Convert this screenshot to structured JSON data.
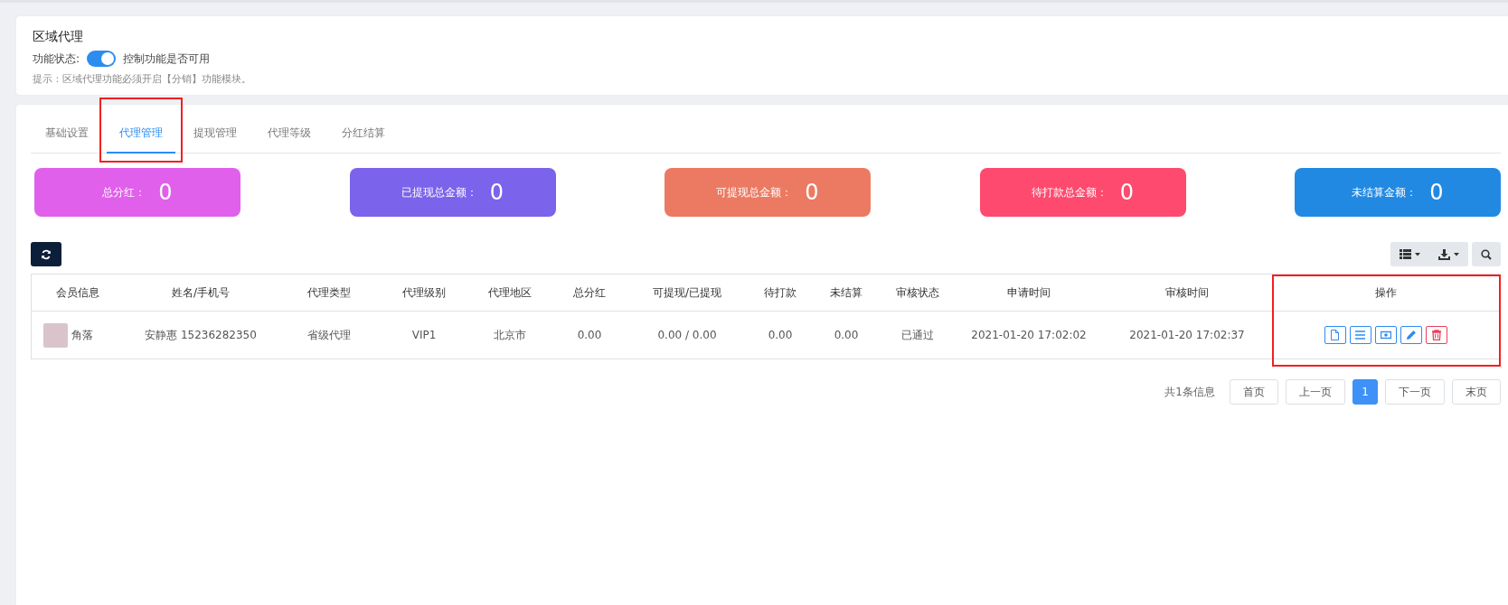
{
  "feature_card": {
    "title": "区域代理",
    "status_label": "功能状态:",
    "toggle_on": true,
    "toggle_hint": "控制功能是否可用",
    "tip": "提示：区域代理功能必须开启【分销】功能模块。"
  },
  "tabs": [
    {
      "label": "基础设置",
      "selected": false,
      "highlighted": false
    },
    {
      "label": "代理管理",
      "selected": true,
      "highlighted": true
    },
    {
      "label": "提现管理",
      "selected": false,
      "highlighted": false
    },
    {
      "label": "代理等级",
      "selected": false,
      "highlighted": false
    },
    {
      "label": "分红结算",
      "selected": false,
      "highlighted": false
    }
  ],
  "stats": [
    {
      "label": "总分红：",
      "value": "0",
      "color": "#e060eb"
    },
    {
      "label": "已提现总金额：",
      "value": "0",
      "color": "#7b63eb"
    },
    {
      "label": "可提现总金额：",
      "value": "0",
      "color": "#ec7a62"
    },
    {
      "label": "待打款总金额：",
      "value": "0",
      "color": "#fd4a6e"
    },
    {
      "label": "未结算金额：",
      "value": "0",
      "color": "#2289e2"
    }
  ],
  "table": {
    "columns": [
      {
        "label": "会员信息",
        "highlighted": false
      },
      {
        "label": "姓名/手机号",
        "highlighted": false
      },
      {
        "label": "代理类型",
        "highlighted": false
      },
      {
        "label": "代理级别",
        "highlighted": false
      },
      {
        "label": "代理地区",
        "highlighted": false
      },
      {
        "label": "总分红",
        "highlighted": false
      },
      {
        "label": "可提现/已提现",
        "highlighted": false
      },
      {
        "label": "待打款",
        "highlighted": false
      },
      {
        "label": "未结算",
        "highlighted": false
      },
      {
        "label": "审核状态",
        "highlighted": false
      },
      {
        "label": "申请时间",
        "highlighted": false
      },
      {
        "label": "审核时间",
        "highlighted": false
      },
      {
        "label": "操作",
        "highlighted": true
      }
    ],
    "rows": [
      {
        "cells": [
          "角落",
          "安静惠 15236282350",
          "省级代理",
          "VIP1",
          "北京市",
          "0.00",
          "0.00 / 0.00",
          "0.00",
          "0.00",
          "已通过",
          "2021-01-20 17:02:02",
          "2021-01-20 17:02:37"
        ],
        "actions": [
          {
            "kind": "detail"
          },
          {
            "kind": "list"
          },
          {
            "kind": "money"
          },
          {
            "kind": "edit"
          },
          {
            "kind": "delete"
          }
        ]
      }
    ]
  },
  "pagination": {
    "summary": "共1条信息",
    "pages": [
      {
        "label": "首页",
        "selected": false
      },
      {
        "label": "上一页",
        "selected": false
      },
      {
        "label": "1",
        "selected": true
      },
      {
        "label": "下一页",
        "selected": false
      },
      {
        "label": "末页",
        "selected": false
      }
    ]
  }
}
